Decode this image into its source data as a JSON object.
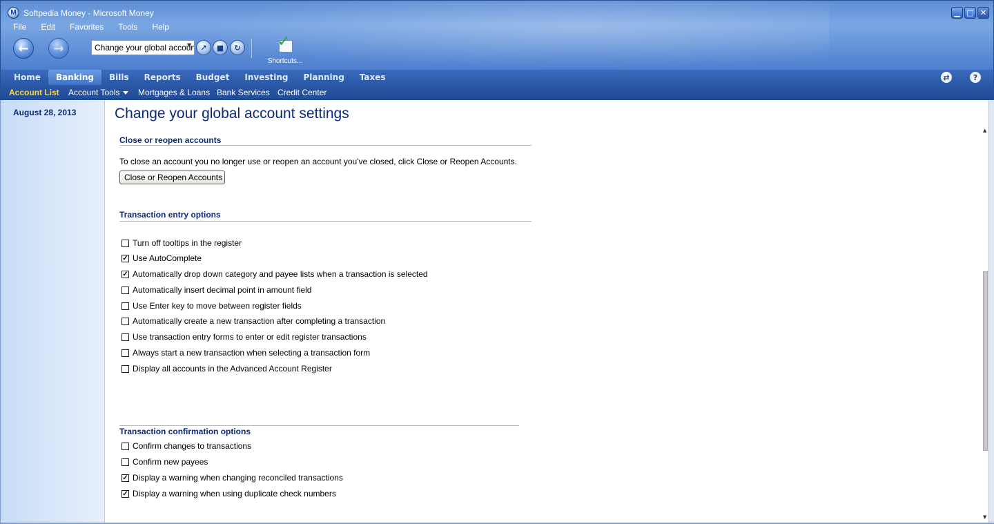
{
  "window": {
    "title": "Softpedia Money - Microsoft Money",
    "logo_letter": "M",
    "minimize": "▁",
    "maximize": "□",
    "close": "✕"
  },
  "menu": [
    "File",
    "Edit",
    "Favorites",
    "Tools",
    "Help"
  ],
  "toolbar": {
    "address_value": "Change your global account",
    "shortcuts_label": "Shortcuts..."
  },
  "tabs": [
    "Home",
    "Banking",
    "Bills",
    "Reports",
    "Budget",
    "Investing",
    "Planning",
    "Taxes"
  ],
  "active_tab": "Banking",
  "subnav": {
    "account_list": "Account List",
    "account_tools": "Account Tools",
    "mortgages": "Mortgages & Loans",
    "bank_services": "Bank Services",
    "credit_center": "Credit Center"
  },
  "sidebar": {
    "date": "August 28, 2013"
  },
  "main": {
    "title": "Change your global account settings",
    "close_section": {
      "title": "Close or reopen accounts",
      "description": "To close an account you no longer use or reopen an account you've closed, click Close or Reopen Accounts.",
      "button": "Close or Reopen Accounts"
    },
    "entry_section": {
      "title": "Transaction entry options",
      "options": [
        {
          "label": "Turn off tooltips in the register",
          "checked": false
        },
        {
          "label": "Use AutoComplete",
          "checked": true
        },
        {
          "label": "Automatically drop down category and payee lists when a transaction is selected",
          "checked": true
        },
        {
          "label": "Automatically insert decimal point in amount field",
          "checked": false
        },
        {
          "label": "Use Enter key to move between register fields",
          "checked": false
        },
        {
          "label": "Automatically create a new transaction after completing a transaction",
          "checked": false
        },
        {
          "label": "Use transaction entry forms to enter or edit register transactions",
          "checked": false
        },
        {
          "label": "Always start a new transaction when selecting a transaction form",
          "checked": false
        },
        {
          "label": "Display all accounts in the Advanced Account Register",
          "checked": false
        }
      ]
    },
    "confirm_section": {
      "title": "Transaction confirmation options",
      "options": [
        {
          "label": "Confirm changes to transactions",
          "checked": false
        },
        {
          "label": "Confirm new payees",
          "checked": false
        },
        {
          "label": "Display a warning when changing reconciled transactions",
          "checked": true
        },
        {
          "label": "Display a warning when using duplicate check numbers",
          "checked": true
        }
      ]
    }
  }
}
